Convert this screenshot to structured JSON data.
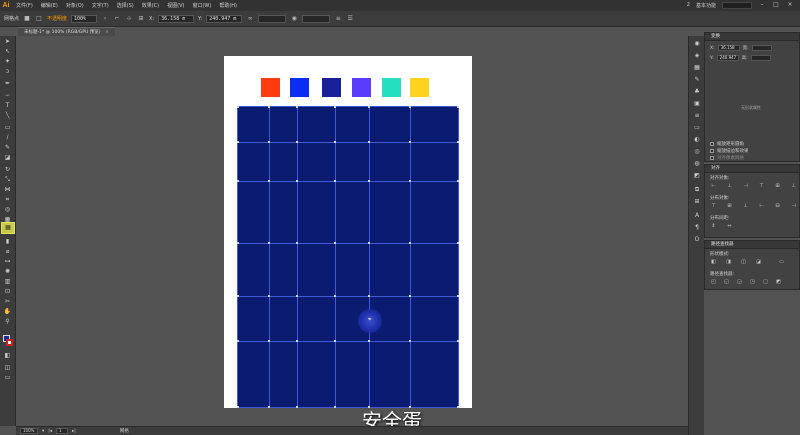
{
  "app": {
    "logo": "Ai"
  },
  "menubar": {
    "items": [
      "文件(F)",
      "编辑(E)",
      "对象(O)",
      "文字(T)",
      "选择(S)",
      "效果(C)",
      "视图(V)",
      "窗口(W)",
      "帮助(H)"
    ],
    "workspace": "基本功能",
    "page_indicator": "2"
  },
  "controlbar": {
    "object_label": "网格点",
    "opacity_label": "不透明度",
    "opacity_value": "100%",
    "x_label": "X:",
    "x_value": "36.158 m",
    "y_label": "Y:",
    "y_value": "240.947 m"
  },
  "doctab": {
    "title": "未标题-1* @ 100% (RGB/GPU 预览)",
    "close": "×"
  },
  "artboard": {
    "swatch_colors": [
      "#ff3b0f",
      "#0b2cf2",
      "#18209a",
      "#5a3cff",
      "#24e0c0",
      "#ffd21f"
    ]
  },
  "statusbar": {
    "zoom": "100%",
    "page": "1",
    "tool": "网格"
  },
  "transform_panel": {
    "header": "变换",
    "x_label": "X:",
    "x_value": "36.158",
    "y_label": "Y:",
    "y_value": "240.947",
    "w_label": "宽:",
    "h_label": "高:",
    "no_props": "无形状属性",
    "opt1": "缩放矩形圆角",
    "opt2": "缩放描边和效果",
    "opt3": "对齐像素网格"
  },
  "align_panel": {
    "header": "对齐",
    "align_objects": "对齐对象:",
    "distribute_objects": "分布对象:",
    "distribute_spacing": "分布间距:"
  },
  "pathfinder_panel": {
    "header": "路径查找器",
    "shape_modes": "形状模式:",
    "pathfinder": "路径查找器:"
  },
  "watermark": "安全蛋"
}
